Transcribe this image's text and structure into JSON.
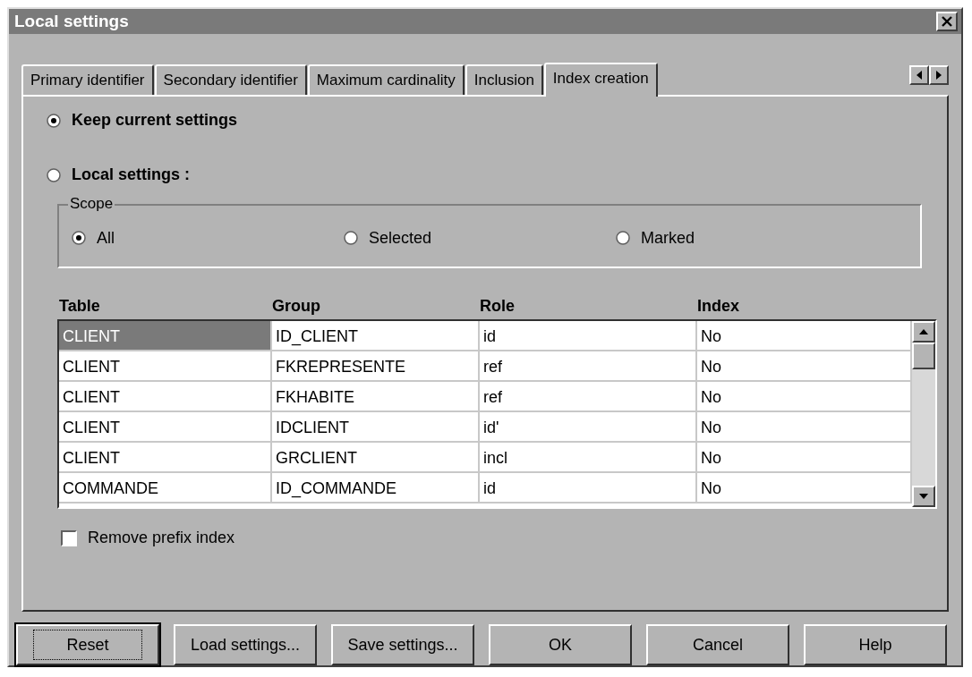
{
  "window": {
    "title": "Local settings"
  },
  "tabs": [
    {
      "label": "Primary identifier",
      "selected": false
    },
    {
      "label": "Secondary identifier",
      "selected": false
    },
    {
      "label": "Maximum cardinality",
      "selected": false
    },
    {
      "label": "Inclusion",
      "selected": false
    },
    {
      "label": "Index creation",
      "selected": true
    }
  ],
  "mode_options": [
    {
      "label": "Keep current settings",
      "selected": true
    },
    {
      "label": "Local settings :",
      "selected": false
    }
  ],
  "scope": {
    "title": "Scope",
    "options": [
      {
        "label": "All",
        "selected": true
      },
      {
        "label": "Selected",
        "selected": false
      },
      {
        "label": "Marked",
        "selected": false
      }
    ]
  },
  "table": {
    "columns": [
      "Table",
      "Group",
      "Role",
      "Index"
    ],
    "rows": [
      {
        "cells": [
          "CLIENT",
          "ID_CLIENT",
          "id",
          "No"
        ],
        "selected": true
      },
      {
        "cells": [
          "CLIENT",
          "FKREPRESENTE",
          "ref",
          "No"
        ],
        "selected": false
      },
      {
        "cells": [
          "CLIENT",
          "FKHABITE",
          "ref",
          "No"
        ],
        "selected": false
      },
      {
        "cells": [
          "CLIENT",
          "IDCLIENT",
          "id'",
          "No"
        ],
        "selected": false
      },
      {
        "cells": [
          "CLIENT",
          "GRCLIENT",
          "incl",
          "No"
        ],
        "selected": false
      },
      {
        "cells": [
          "COMMANDE",
          "ID_COMMANDE",
          "id",
          "No"
        ],
        "selected": false
      }
    ]
  },
  "remove_prefix": {
    "label": "Remove prefix index",
    "checked": false
  },
  "buttons": [
    {
      "label": "Reset",
      "focused": true
    },
    {
      "label": "Load settings...",
      "focused": false
    },
    {
      "label": "Save settings...",
      "focused": false
    },
    {
      "label": "OK",
      "focused": false
    },
    {
      "label": "Cancel",
      "focused": false
    },
    {
      "label": "Help",
      "focused": false
    }
  ]
}
